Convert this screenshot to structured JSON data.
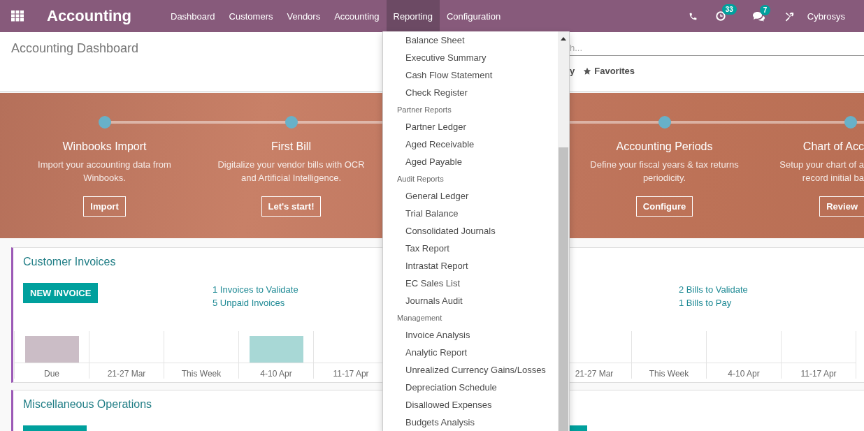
{
  "navbar": {
    "app_title": "Accounting",
    "menu": [
      {
        "label": "Dashboard",
        "selected": false
      },
      {
        "label": "Customers",
        "selected": false
      },
      {
        "label": "Vendors",
        "selected": false
      },
      {
        "label": "Accounting",
        "selected": false
      },
      {
        "label": "Reporting",
        "selected": true
      },
      {
        "label": "Configuration",
        "selected": false
      }
    ],
    "activity_badge": "33",
    "messages_badge": "7",
    "user": "Cybrosys"
  },
  "control_panel": {
    "breadcrumb": "Accounting Dashboard",
    "search": {
      "placeholder": "h..."
    },
    "filters": [
      {
        "label": "y",
        "kind": "plain"
      },
      {
        "label": "Favorites",
        "kind": "favorites"
      }
    ]
  },
  "onboarding": {
    "steps": [
      {
        "title": "Winbooks Import",
        "description": "Import your accounting data from\nWinbooks.",
        "button": "Import"
      },
      {
        "title": "First Bill",
        "description": "Digitalize your vendor bills with OCR\nand Artificial Intelligence.",
        "button": "Let's start!"
      },
      {
        "title": "Accounting Periods",
        "description": "Define your fiscal years & tax returns\nperiodicity.",
        "button": "Configure"
      },
      {
        "title": "Chart of Acc",
        "description": "Setup your chart of a\nrecord initial ba",
        "button": "Review"
      }
    ]
  },
  "journal_rows": [
    {
      "cards": [
        {
          "title": "Customer Invoices",
          "button": "NEW INVOICE",
          "links": [
            "1 Invoices to Validate",
            "5 Unpaid Invoices"
          ],
          "chart": {
            "columns": [
              {
                "label": "Due",
                "color": "#cbbdc6"
              },
              {
                "label": "21-27 Mar"
              },
              {
                "label": "This Week"
              },
              {
                "label": "4-10 Apr",
                "color": "#a8d8d6"
              },
              {
                "label": "11-17 Apr"
              }
            ]
          }
        },
        {
          "links": [
            "2 Bills to Validate",
            "1 Bills to Pay"
          ],
          "chart": {
            "columns": [
              {
                "label": "21-27 Mar"
              },
              {
                "label": "This Week"
              },
              {
                "label": "4-10 Apr"
              },
              {
                "label": "11-17 Apr"
              }
            ]
          }
        }
      ]
    },
    {
      "cards": [
        {
          "title": "Miscellaneous Operations",
          "button_stub": true
        },
        {
          "button_stub": true
        }
      ]
    }
  ],
  "reporting_menu": {
    "entries": [
      {
        "kind": "item",
        "label": "Balance Sheet"
      },
      {
        "kind": "item",
        "label": "Executive Summary"
      },
      {
        "kind": "item",
        "label": "Cash Flow Statement"
      },
      {
        "kind": "item",
        "label": "Check Register"
      },
      {
        "kind": "header",
        "label": "Partner Reports"
      },
      {
        "kind": "item",
        "label": "Partner Ledger"
      },
      {
        "kind": "item",
        "label": "Aged Receivable"
      },
      {
        "kind": "item",
        "label": "Aged Payable"
      },
      {
        "kind": "header",
        "label": "Audit Reports"
      },
      {
        "kind": "item",
        "label": "General Ledger"
      },
      {
        "kind": "item",
        "label": "Trial Balance"
      },
      {
        "kind": "item",
        "label": "Consolidated Journals"
      },
      {
        "kind": "item",
        "label": "Tax Report"
      },
      {
        "kind": "item",
        "label": "Intrastat Report"
      },
      {
        "kind": "item",
        "label": "EC Sales List"
      },
      {
        "kind": "item",
        "label": "Journals Audit"
      },
      {
        "kind": "header",
        "label": "Management"
      },
      {
        "kind": "item",
        "label": "Invoice Analysis"
      },
      {
        "kind": "item",
        "label": "Analytic Report"
      },
      {
        "kind": "item",
        "label": "Unrealized Currency Gains/Losses"
      },
      {
        "kind": "item",
        "label": "Depreciation Schedule"
      },
      {
        "kind": "item",
        "label": "Disallowed Expenses"
      },
      {
        "kind": "item",
        "label": "Budgets Analysis"
      }
    ]
  }
}
